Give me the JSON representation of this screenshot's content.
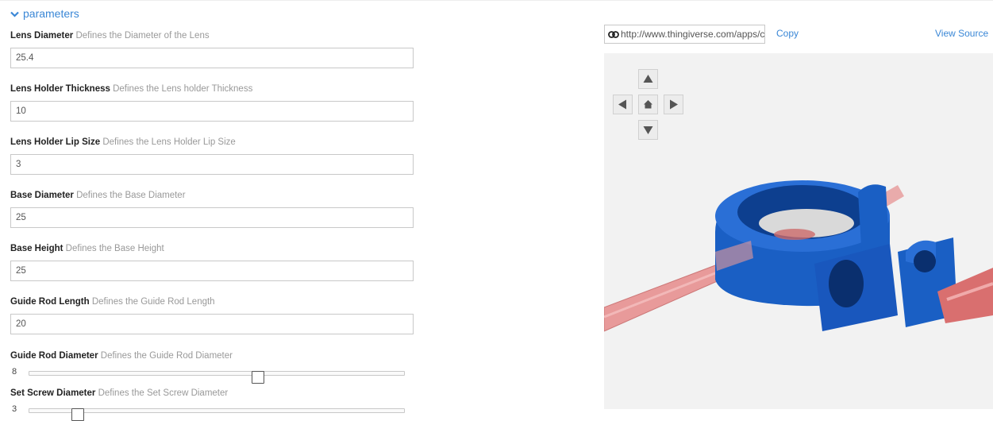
{
  "section": {
    "title": "parameters"
  },
  "params": [
    {
      "name": "Lens Diameter",
      "description": "Defines the Diameter of the Lens",
      "value": "25.4"
    },
    {
      "name": "Lens Holder Thickness",
      "description": "Defines the Lens holder Thickness",
      "value": "10"
    },
    {
      "name": "Lens Holder Lip Size",
      "description": "Defines the Lens Holder Lip Size",
      "value": "3"
    },
    {
      "name": "Base Diameter",
      "description": "Defines the Base Diameter",
      "value": "25"
    },
    {
      "name": "Base Height",
      "description": "Defines the Base Height",
      "value": "25"
    },
    {
      "name": "Guide Rod Length",
      "description": "Defines the Guide Rod Length",
      "value": "20"
    }
  ],
  "sliders": [
    {
      "name": "Guide Rod Diameter",
      "description": "Defines the Guide Rod Diameter",
      "value": "8",
      "fraction": 0.61
    },
    {
      "name": "Set Screw Diameter",
      "description": "Defines the Set Screw Diameter",
      "value": "3",
      "fraction": 0.13
    }
  ],
  "share": {
    "url": "http://www.thingiverse.com/apps/customizer",
    "copy_label": "Copy",
    "view_source_label": "View Source"
  },
  "colors": {
    "accent": "#3a87d6",
    "model": "#1a5fc4",
    "rod": "#e88a8a",
    "viewer_bg": "#f2f2f2"
  },
  "icons": [
    "chevron-down-icon",
    "link-icon",
    "arrow-up-icon",
    "arrow-left-icon",
    "home-icon",
    "arrow-right-icon",
    "arrow-down-icon"
  ]
}
